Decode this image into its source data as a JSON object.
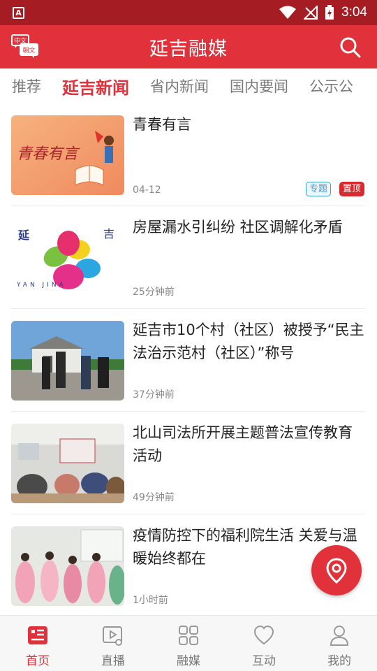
{
  "status_bar": {
    "time": "3:04",
    "app_badge": "A"
  },
  "header": {
    "title": "延吉融媒",
    "lang_top": "中文",
    "lang_bottom": "朝文"
  },
  "tabs": [
    {
      "label": "推荐",
      "active": false
    },
    {
      "label": "延吉新闻",
      "active": true
    },
    {
      "label": "省内新闻",
      "active": false
    },
    {
      "label": "国内要闻",
      "active": false
    },
    {
      "label": "公示公",
      "active": false
    }
  ],
  "news": [
    {
      "title": "青春有言",
      "time": "04-12",
      "badge_topic": "专题",
      "badge_top": "置顶",
      "thumb_text": "青春有言"
    },
    {
      "title": "房屋漏水引纠纷 社区调解化矛盾",
      "time": "25分钟前",
      "thumb_text": "YAN JINA"
    },
    {
      "title": "延吉市10个村（社区）被授予“民主法治示范村（社区）”称号",
      "time": "37分钟前"
    },
    {
      "title": "北山司法所开展主题普法宣传教育活动",
      "time": "49分钟前"
    },
    {
      "title": "疫情防控下的福利院生活 关爱与温暖始终都在",
      "time": "1小时前"
    }
  ],
  "bottom_nav": [
    {
      "label": "首页",
      "icon": "home-news-icon",
      "active": true
    },
    {
      "label": "直播",
      "icon": "live-video-icon",
      "active": false
    },
    {
      "label": "融媒",
      "icon": "grid-icon",
      "active": false
    },
    {
      "label": "互动",
      "icon": "heart-icon",
      "active": false
    },
    {
      "label": "我的",
      "icon": "user-icon",
      "active": false
    }
  ],
  "colors": {
    "primary": "#e1313a",
    "status_bar": "#a51c22",
    "topic_badge": "#39a0e0"
  }
}
